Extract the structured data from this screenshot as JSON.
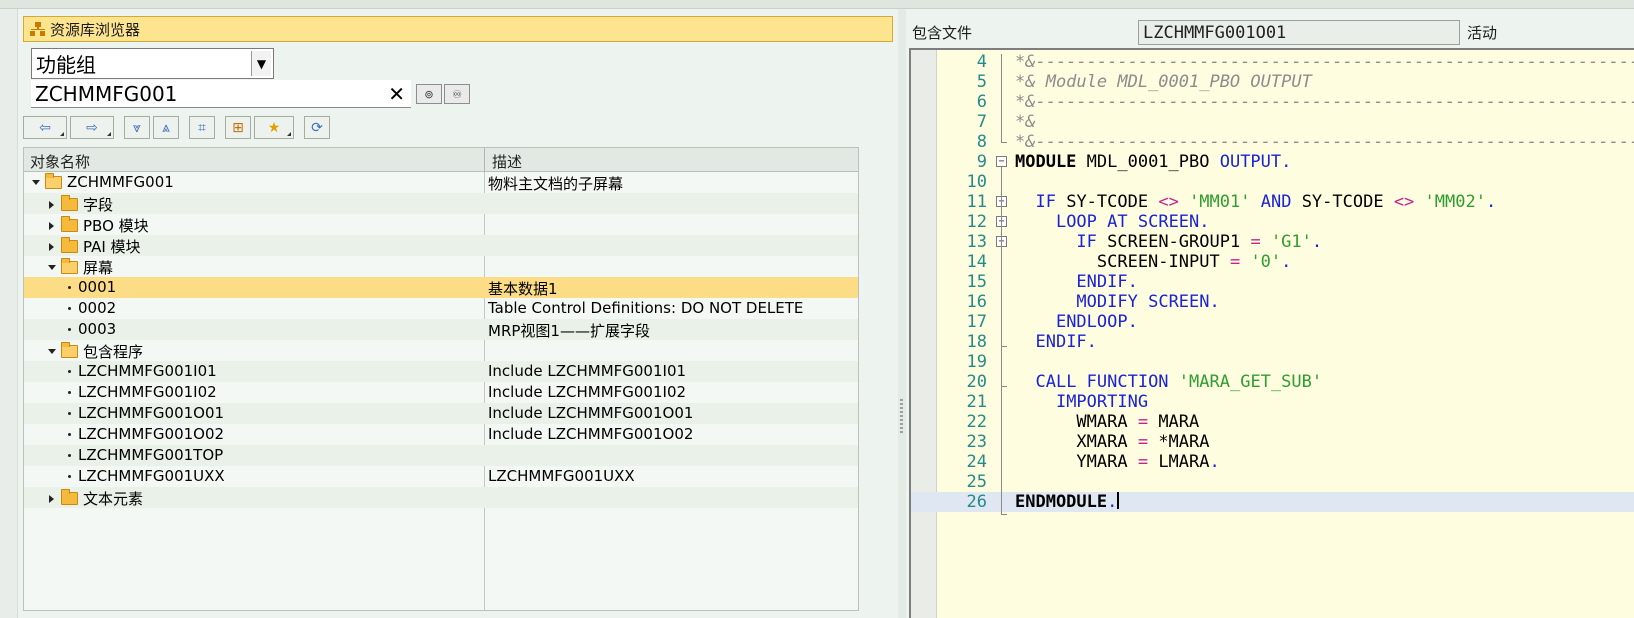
{
  "browser": {
    "title": "资源库浏览器",
    "object_type": "功能组",
    "object_name": "ZCHMMFG001",
    "clear_symbol": "✕",
    "columns": {
      "name": "对象名称",
      "description": "描述"
    },
    "tree": [
      {
        "label": "ZCHMMFG001",
        "desc": "物料主文档的子屏幕"
      },
      {
        "label": "字段",
        "desc": ""
      },
      {
        "label": "PBO 模块",
        "desc": ""
      },
      {
        "label": "PAI 模块",
        "desc": ""
      },
      {
        "label": "屏幕",
        "desc": ""
      },
      {
        "label": "0001",
        "desc": "基本数据1"
      },
      {
        "label": "0002",
        "desc": "Table Control Definitions: DO NOT DELETE"
      },
      {
        "label": "0003",
        "desc": "MRP视图1——扩展字段"
      },
      {
        "label": "包含程序",
        "desc": ""
      },
      {
        "label": "LZCHMMFG001I01",
        "desc": "Include LZCHMMFG001I01"
      },
      {
        "label": "LZCHMMFG001I02",
        "desc": "Include LZCHMMFG001I02"
      },
      {
        "label": "LZCHMMFG001O01",
        "desc": "Include LZCHMMFG001O01"
      },
      {
        "label": "LZCHMMFG001O02",
        "desc": "Include LZCHMMFG001O02"
      },
      {
        "label": "LZCHMMFG001TOP",
        "desc": ""
      },
      {
        "label": "LZCHMMFG001UXX",
        "desc": "LZCHMMFG001UXX"
      },
      {
        "label": "文本元素",
        "desc": ""
      }
    ]
  },
  "editor": {
    "include_label": "包含文件",
    "include_name": "LZCHMMFG001O01",
    "status": "活动",
    "lines": [
      {
        "n": "4",
        "text": "*&---------------------------------------------------------------------"
      },
      {
        "n": "5",
        "text": "*& Module MDL_0001_PBO OUTPUT"
      },
      {
        "n": "6",
        "text": "*&---------------------------------------------------------------------"
      },
      {
        "n": "7",
        "text": "*&"
      },
      {
        "n": "8",
        "text": "*&---------------------------------------------------------------------"
      },
      {
        "n": "9",
        "text": "MODULE MDL_0001_PBO OUTPUT."
      },
      {
        "n": "10",
        "text": ""
      },
      {
        "n": "11",
        "text": "  IF SY-TCODE <> 'MM01' AND SY-TCODE <> 'MM02'."
      },
      {
        "n": "12",
        "text": "    LOOP AT SCREEN."
      },
      {
        "n": "13",
        "text": "      IF SCREEN-GROUP1 = 'G1'."
      },
      {
        "n": "14",
        "text": "        SCREEN-INPUT = '0'."
      },
      {
        "n": "15",
        "text": "      ENDIF."
      },
      {
        "n": "16",
        "text": "      MODIFY SCREEN."
      },
      {
        "n": "17",
        "text": "    ENDLOOP."
      },
      {
        "n": "18",
        "text": "  ENDIF."
      },
      {
        "n": "19",
        "text": ""
      },
      {
        "n": "20",
        "text": "  CALL FUNCTION 'MARA_GET_SUB'"
      },
      {
        "n": "21",
        "text": "    IMPORTING"
      },
      {
        "n": "22",
        "text": "      WMARA = MARA"
      },
      {
        "n": "23",
        "text": "      XMARA = *MARA"
      },
      {
        "n": "24",
        "text": "      YMARA = LMARA."
      },
      {
        "n": "25",
        "text": ""
      },
      {
        "n": "26",
        "text": "ENDMODULE."
      }
    ]
  },
  "colors": {
    "selected_row": "#fddc86",
    "title_bar": "#fde48f",
    "keyword": "#1a23d6",
    "string": "#2e9e2e",
    "comment": "#8c8c8c",
    "line_number": "#238b8b"
  }
}
